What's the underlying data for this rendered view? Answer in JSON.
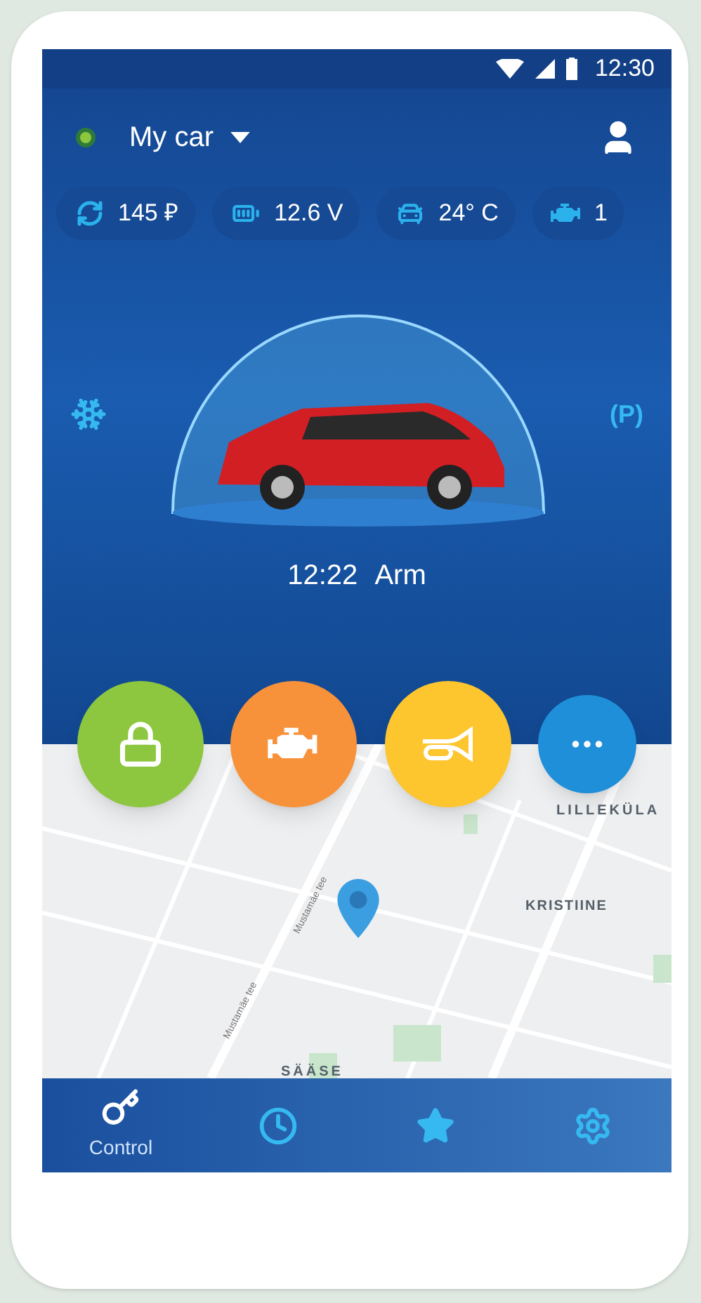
{
  "status_bar": {
    "time": "12:30"
  },
  "header": {
    "online": true,
    "car_name": "My car"
  },
  "chips": [
    {
      "kind": "balance",
      "value": "145 ₽"
    },
    {
      "kind": "battery",
      "value": "12.6 V"
    },
    {
      "kind": "car",
      "value": "24° C"
    },
    {
      "kind": "engine",
      "value": "1"
    }
  ],
  "side_controls": [
    {
      "kind": "climate"
    },
    {
      "kind": "parking",
      "label": "(P)"
    }
  ],
  "state": {
    "time": "12:22",
    "mode": "Arm"
  },
  "actions": [
    {
      "kind": "lock",
      "color": "#8dc63f"
    },
    {
      "kind": "engine",
      "color": "#f7923a"
    },
    {
      "kind": "horn",
      "color": "#fdc52e"
    },
    {
      "kind": "more",
      "color": "#1e8fd8"
    }
  ],
  "map": {
    "places": [
      "LILLEKÜLA",
      "KRISTIINE",
      "SÄÄSE"
    ],
    "streets": [
      "Mustamäe tee",
      "Mustamäe tee"
    ]
  },
  "nav": [
    {
      "kind": "control",
      "label": "Control",
      "selected": true
    },
    {
      "kind": "history",
      "selected": false
    },
    {
      "kind": "favorites",
      "selected": false
    },
    {
      "kind": "settings",
      "selected": false
    }
  ]
}
